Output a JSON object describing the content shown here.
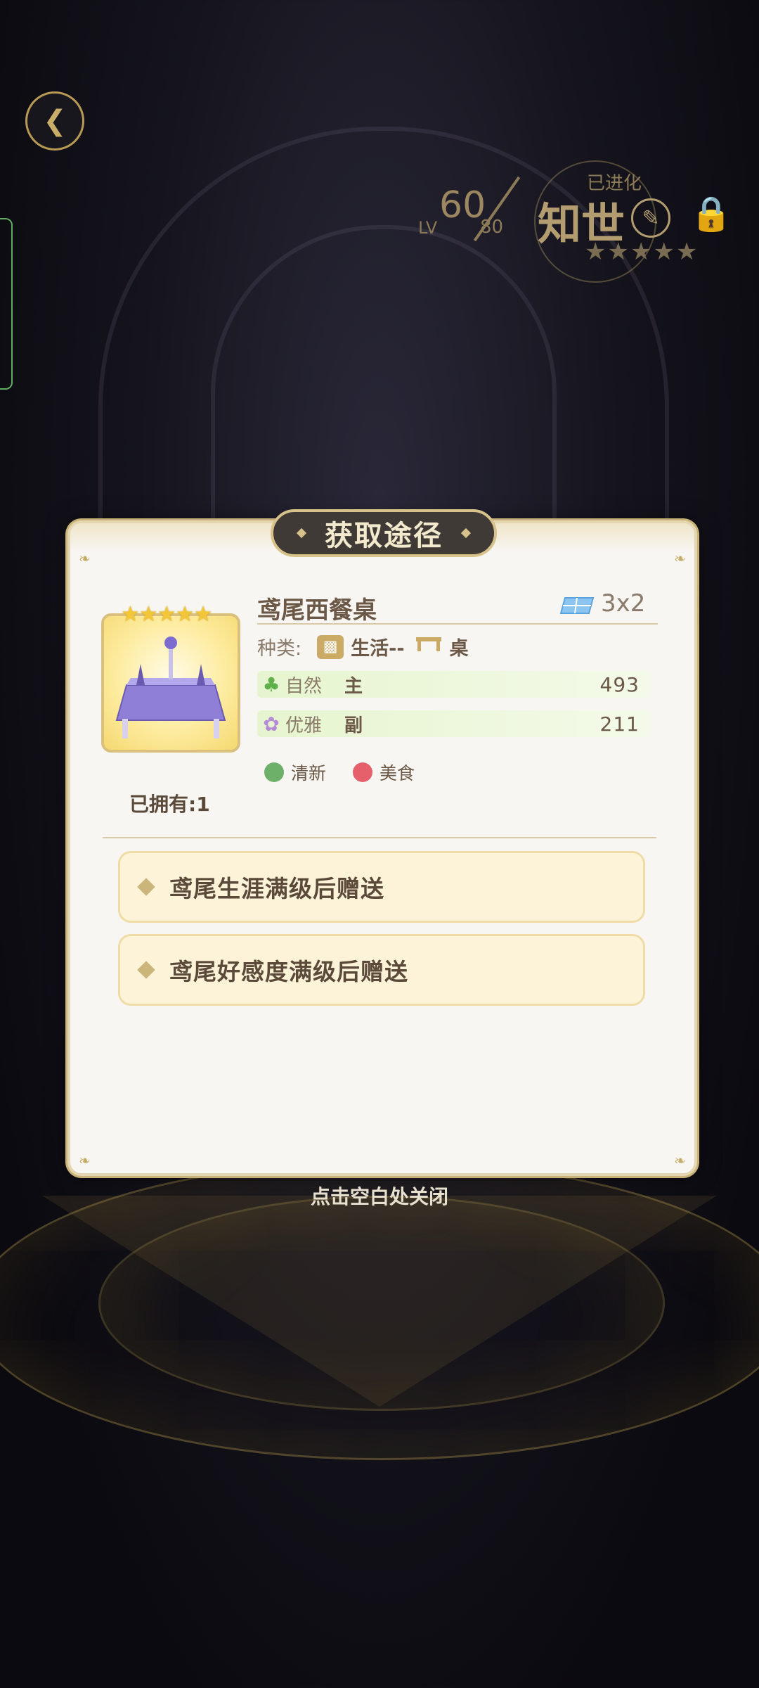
{
  "header": {
    "back_icon": "winged-back-icon",
    "level_label": "LV",
    "level_current": "60",
    "level_max": "80",
    "evolved_label": "已进化",
    "character_name": "知世",
    "stars": "★★★★★"
  },
  "dialog": {
    "title": "获取途径",
    "item": {
      "name": "鸢尾西餐桌",
      "size": "3x2",
      "stars": "★★★★★",
      "owned": "已拥有:1",
      "type_label": "种类:",
      "type_category": "生活--",
      "type_sub": "桌",
      "attributes": [
        {
          "icon": "clover-icon",
          "name": "自然",
          "role": "主",
          "value": "493",
          "color": "#5fb04a"
        },
        {
          "icon": "swan-icon",
          "name": "优雅",
          "role": "副",
          "value": "211",
          "color": "#b58ad6"
        }
      ],
      "tags": [
        {
          "icon": "leaf-swirl-icon",
          "label": "清新",
          "color": "#6db06a"
        },
        {
          "icon": "food-icon",
          "label": "美食",
          "color": "#e6606b"
        }
      ]
    },
    "sources": [
      {
        "label": "鸢尾生涯满级后赠送"
      },
      {
        "label": "鸢尾好感度满级后赠送"
      }
    ]
  },
  "close_hint": "点击空白处关闭"
}
